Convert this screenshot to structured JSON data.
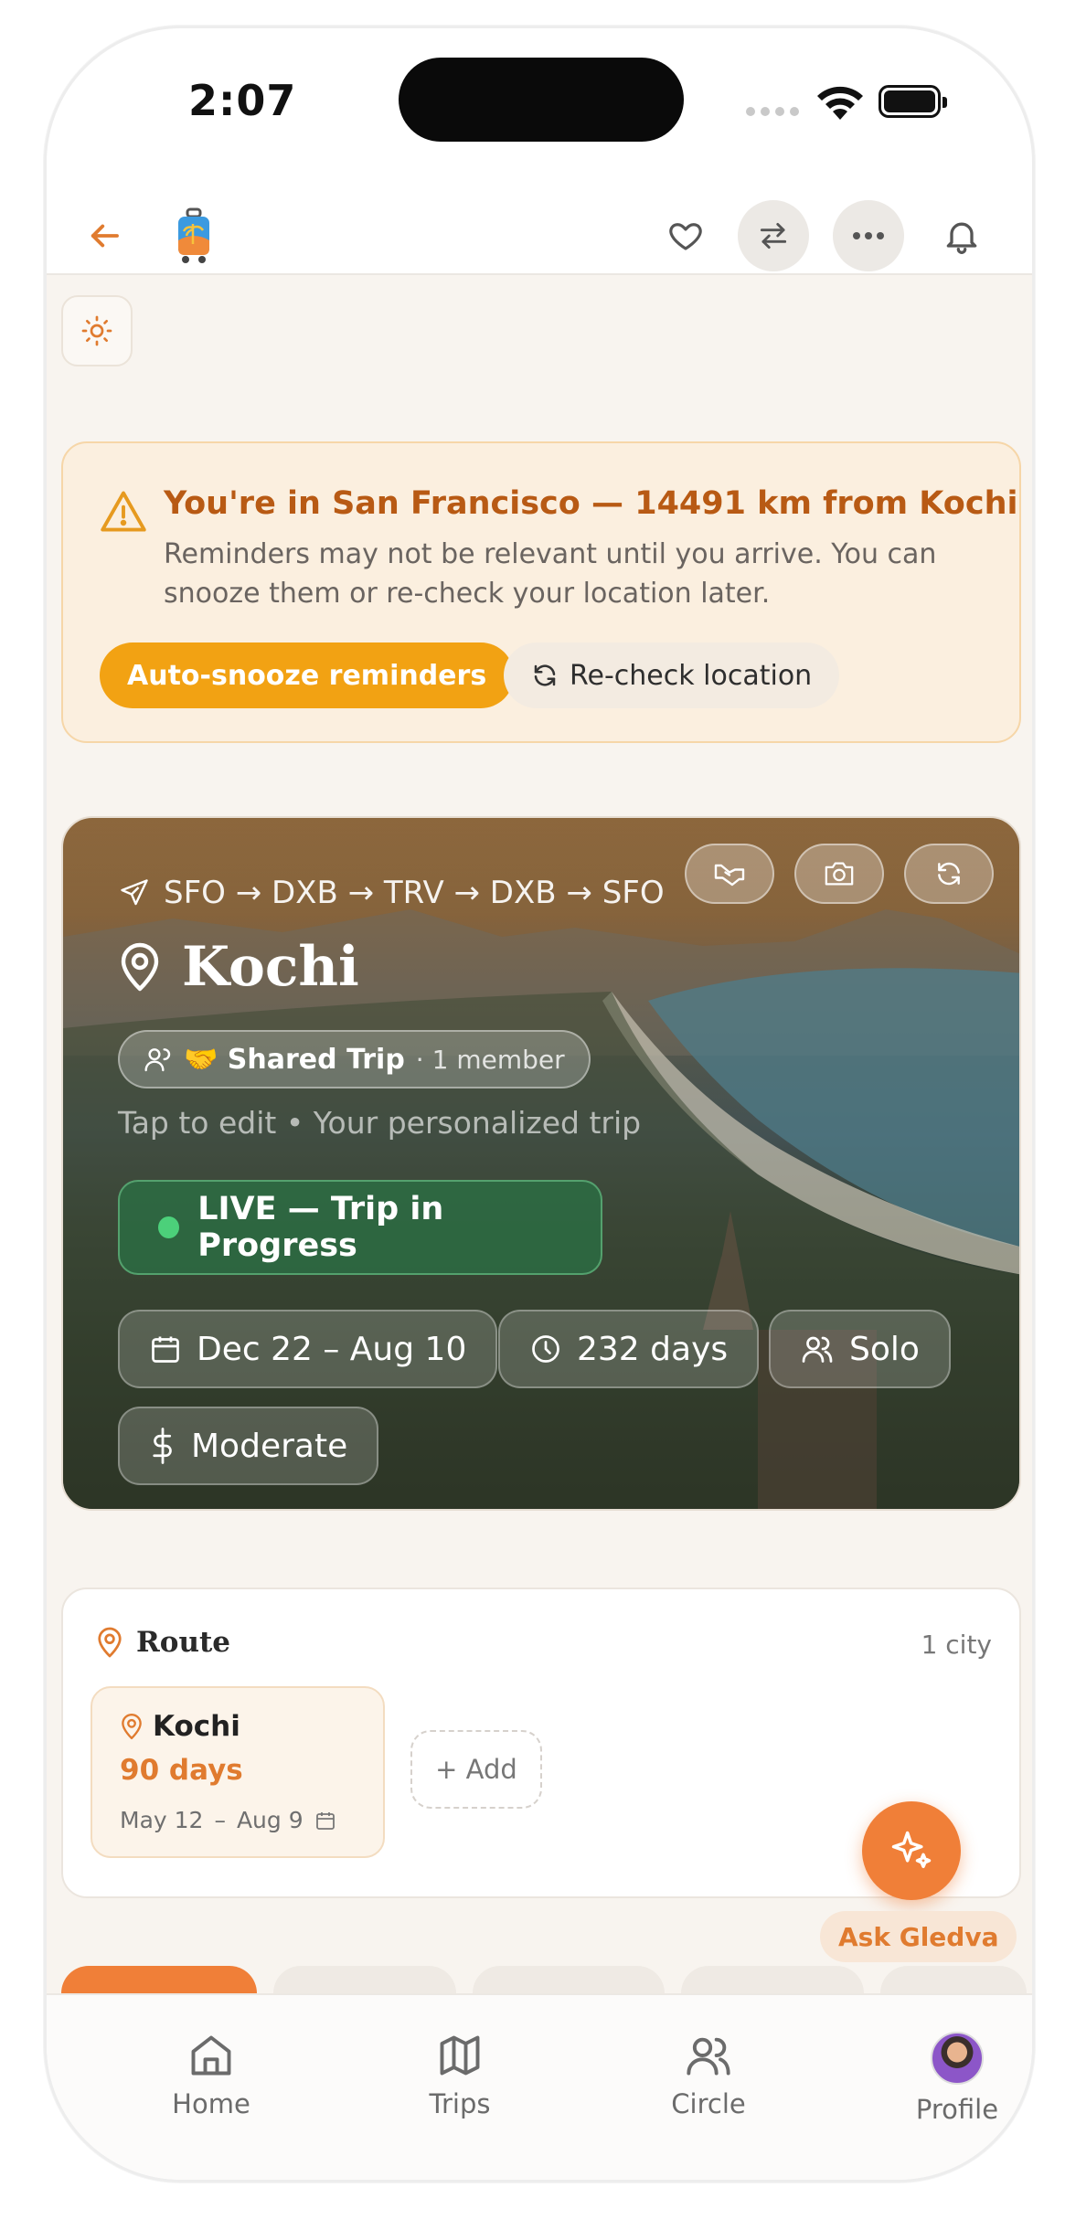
{
  "status_bar": {
    "time": "2:07"
  },
  "warning": {
    "title": "You're in San Francisco — 14491 km from Kochi",
    "body": "Reminders may not be relevant until you arrive. You can snooze them or re-check your location later.",
    "primary_button": "Auto-snooze reminders",
    "secondary_button": "Re-check location"
  },
  "trip": {
    "route": "SFO → DXB → TRV → DXB → SFO",
    "city": "Kochi",
    "shared_label": "🤝 Shared Trip",
    "members": "· 1 member",
    "hint": "Tap to edit • Your personalized trip",
    "live": "LIVE — Trip in Progress",
    "dates": "Dec 22 – Aug 10",
    "duration": "232 days",
    "travelers": "Solo",
    "budget": "Moderate"
  },
  "route_card": {
    "title": "Route",
    "count": "1 city",
    "city": {
      "name": "Kochi",
      "days": "90 days",
      "start": "May 12",
      "separator": "–",
      "end": "Aug 9"
    },
    "add_label": "+ Add"
  },
  "fab": {
    "label": "Ask Gledva"
  },
  "nav": {
    "items": [
      {
        "label": "Home",
        "icon": "home-icon"
      },
      {
        "label": "Trips",
        "icon": "map-icon"
      },
      {
        "label": "Circle",
        "icon": "users-icon"
      },
      {
        "label": "Profile",
        "icon": "avatar"
      }
    ]
  },
  "colors": {
    "accent": "#F07F38",
    "warning_button": "#F2A213",
    "live": "#4CD07A"
  }
}
